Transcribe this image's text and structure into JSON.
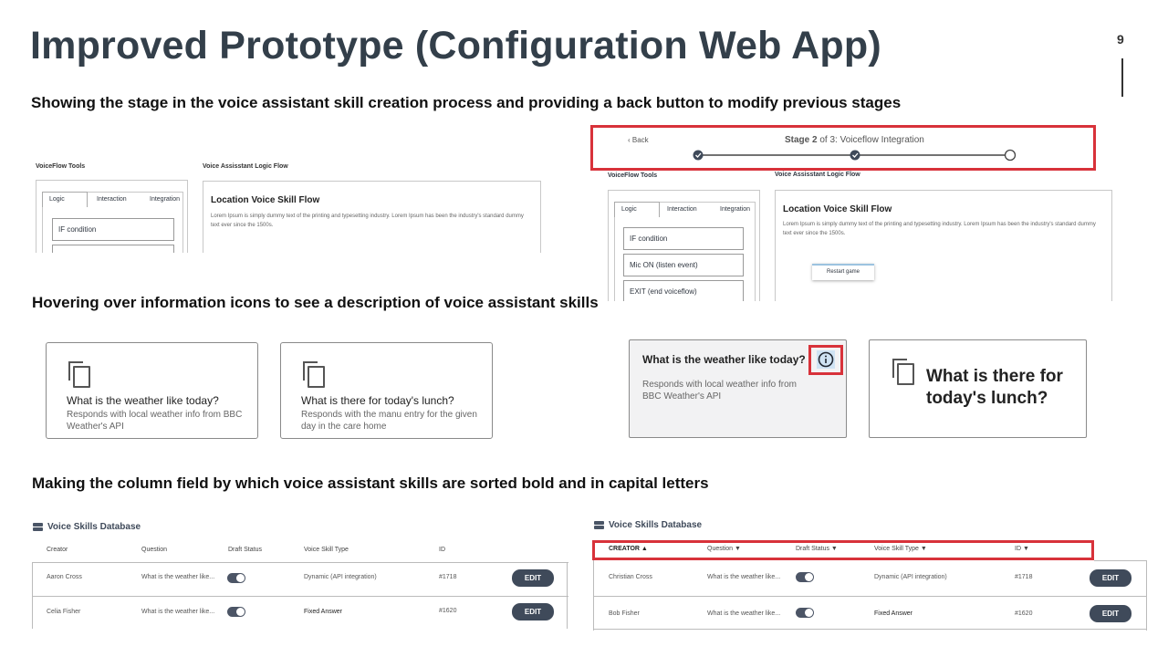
{
  "title": "Improved Prototype (Configuration Web App)",
  "page_number": "9",
  "section1": {
    "heading": "Showing the stage in the voice assistant skill creation process and providing a back button to modify previous stages"
  },
  "section2": {
    "heading": "Hovering over information icons to see a description of voice assistant skills"
  },
  "section3": {
    "heading": "Making the column field by which voice assistant skills are sorted bold and in capital letters"
  },
  "tools": {
    "title": "VoiceFlow Tools",
    "tab_logic": "Logic",
    "tab_interaction": "Interaction",
    "tab_integration": "Integration",
    "item1": "IF condition",
    "item2": "Mic ON (listen event)",
    "item3": "EXIT (end voiceflow)"
  },
  "logic": {
    "title": "Voice Assisstant Logic Flow",
    "flow_title": "Location Voice Skill Flow",
    "lorem": "Lorem Ipsum is simply dummy text of the printing and typesetting industry. Lorem Ipsum has been the industry's standard dummy text ever since the 1500s.",
    "node": "Restart game"
  },
  "stage": {
    "back": "Back",
    "label_bold": "Stage 2",
    "label_rest": " of 3: Voiceflow Integration"
  },
  "cards": [
    {
      "question": "What is the weather like today?",
      "answer": "Responds with local weather info from BBC Weather's API"
    },
    {
      "question": "What is there for today's lunch?",
      "answer": "Responds with the manu entry for the given day in the care home"
    }
  ],
  "hover_card": {
    "question": "What is the weather like today?",
    "answer": "Responds with local weather info from BBC Weather's API"
  },
  "large_card": {
    "question": "What is there for today's lunch?"
  },
  "db": {
    "title": "Voice Skills Database",
    "edit": "EDIT",
    "headers_before": [
      "Creator",
      "Question",
      "Draft Status",
      "Voice Skill Type",
      "ID"
    ],
    "headers_after": [
      "CREATOR ▲",
      "Question ▼",
      "Draft Status ▼",
      "Voice Skill Type ▼",
      "ID ▼"
    ],
    "rows_before": [
      {
        "creator": "Aaron Cross",
        "question": "What is the weather like...",
        "type": "Dynamic (API integration)",
        "id": "#1718"
      },
      {
        "creator": "Celia Fisher",
        "question": "What is the weather like...",
        "type": "Fixed Answer",
        "id": "#1620"
      }
    ],
    "rows_after": [
      {
        "creator": "Christian Cross",
        "question": "What is the weather like...",
        "type": "Dynamic (API integration)",
        "id": "#1718"
      },
      {
        "creator": "Bob Fisher",
        "question": "What is the weather like...",
        "type": "Fixed Answer",
        "id": "#1620"
      }
    ]
  },
  "colors": {
    "accent_red": "#d8323a",
    "title": "#333f4a",
    "button": "#3f4a5a"
  }
}
